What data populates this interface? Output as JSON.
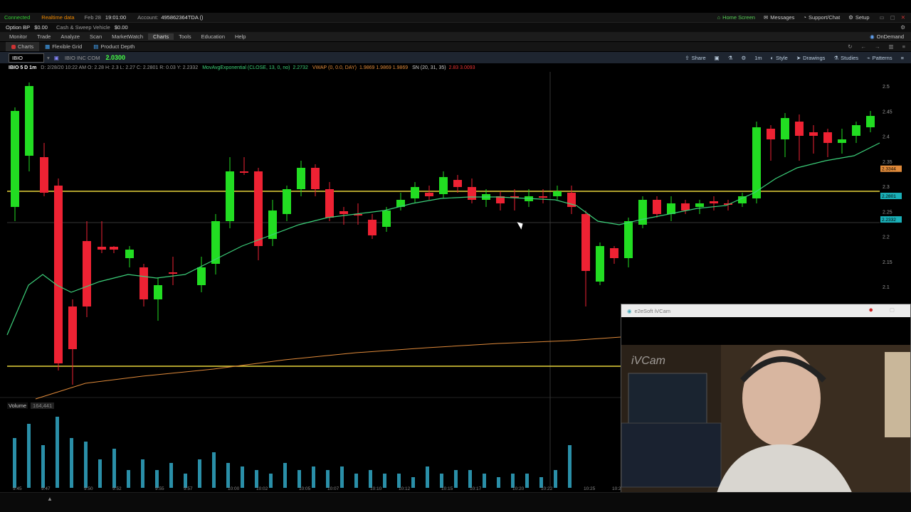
{
  "status": {
    "connected": "Connected",
    "realtime": "Realtime data",
    "date": "Feb 28",
    "time": "19:01:00",
    "account_label": "Account:",
    "account": "495862364TDA ()",
    "home_screen": "Home Screen",
    "messages": "Messages",
    "support": "Support/Chat",
    "setup": "Setup"
  },
  "account_bar": {
    "option_bp_label": "Option BP",
    "option_bp": "$0.00",
    "cash_label": "Cash & Sweep Vehicle",
    "cash": "$0.00"
  },
  "menu": {
    "items": [
      "Monitor",
      "Trade",
      "Analyze",
      "Scan",
      "MarketWatch",
      "Charts",
      "Tools",
      "Education",
      "Help"
    ],
    "ondemand": "OnDemand"
  },
  "tabs": {
    "charts": "Charts",
    "flexible_grid": "Flexible Grid",
    "product_depth": "Product Depth"
  },
  "toolbar": {
    "symbol": "IBIO",
    "company": "IBIO INC COM",
    "price": "2.0300",
    "share": "Share",
    "style": "Style",
    "drawings": "Drawings",
    "studies": "Studies",
    "patterns": "Patterns",
    "timeframe": "1m"
  },
  "info_line": {
    "symbol_period": "IBIO 5 D 1m",
    "ohlc": "D: 2/28/20 10:22 AM  O: 2.28  H: 2.3  L: 2.27  C: 2.2801  R: 0.03  Y: 2.2332",
    "mavg": "MovAvgExponential (CLOSE, 13, 0, no)",
    "mavg_value": "2.2732",
    "vwap": "VWAP (0, 0.0, DAY)",
    "vwap_values": "1.9869  1.9869  1.9869",
    "sn": "SN (20, 31, 35)",
    "sn_values": "2.83  3.0093"
  },
  "chart_data": {
    "type": "candlestick",
    "symbol": "IBIO",
    "y_ticks": [
      "2.5",
      "2.45",
      "2.4",
      "2.35",
      "2.3",
      "2.25",
      "2.2",
      "2.15",
      "2.1"
    ],
    "x_ticks": [
      "9:45",
      "9:47",
      "9:50",
      "9:52",
      "9:55",
      "9:57",
      "10:00",
      "10:02",
      "10:05",
      "10:07",
      "10:10",
      "10:12",
      "10:15",
      "10:17",
      "10:20",
      "10:22",
      "10:25",
      "10:27"
    ],
    "price_badge_1": "2.3344",
    "price_badge_2": "2.2801",
    "price_badge_3": "2.2332",
    "volume_label": "Volume",
    "volume_value": "164,441"
  },
  "webcam": {
    "title": "e2eSoft iVCam",
    "overlay": "iVCam"
  },
  "colors": {
    "up": "#22dd22",
    "down": "#ee2233",
    "ema": "#3cd07a",
    "level": "#e6d23a",
    "vwap": "#e08a3a",
    "volume": "#2a8fa8"
  }
}
